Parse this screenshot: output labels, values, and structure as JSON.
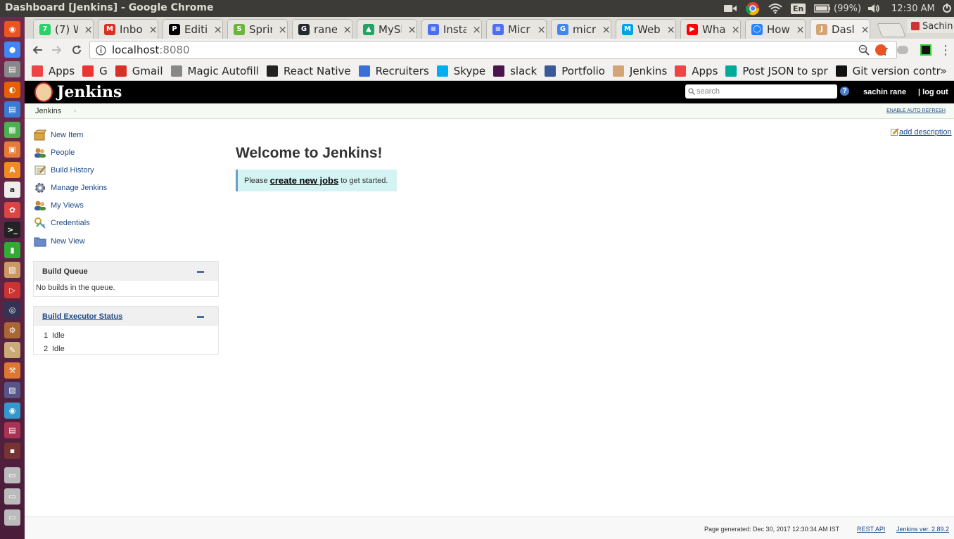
{
  "os": {
    "window_title": "Dashboard [Jenkins] - Google Chrome",
    "battery": "(99%)",
    "clock": "12:30 AM",
    "keyboard": "En"
  },
  "browser": {
    "tabs": [
      {
        "label": "(7) W",
        "fav_color": "#25d366",
        "fav_glyph": "7"
      },
      {
        "label": "Inbo",
        "fav_color": "#d93025",
        "fav_glyph": "M"
      },
      {
        "label": "Editi",
        "fav_color": "#000000",
        "fav_glyph": "P"
      },
      {
        "label": "Sprir",
        "fav_color": "#6db33f",
        "fav_glyph": "S"
      },
      {
        "label": "rane",
        "fav_color": "#24292e",
        "fav_glyph": "G"
      },
      {
        "label": "MySl",
        "fav_color": "#1fa463",
        "fav_glyph": "▲"
      },
      {
        "label": "Insta",
        "fav_color": "#4c6ef5",
        "fav_glyph": "≡"
      },
      {
        "label": "Micr",
        "fav_color": "#4c6ef5",
        "fav_glyph": "≡"
      },
      {
        "label": "micr",
        "fav_color": "#4285f4",
        "fav_glyph": "G"
      },
      {
        "label": "Web",
        "fav_color": "#00a2e8",
        "fav_glyph": "M"
      },
      {
        "label": "Wha",
        "fav_color": "#ff0000",
        "fav_glyph": "▶"
      },
      {
        "label": "How",
        "fav_color": "#2684ff",
        "fav_glyph": "◯"
      },
      {
        "label": "Dasl",
        "fav_color": "#d4a574",
        "fav_glyph": "J"
      }
    ],
    "profile_name": "Sachin",
    "url_host": "localhost",
    "url_port": ":8080",
    "bookmarks": [
      {
        "label": "Apps",
        "color": "#e44"
      },
      {
        "label": "G",
        "color": "#e33"
      },
      {
        "label": "Gmail",
        "color": "#d93025"
      },
      {
        "label": "Magic Autofill",
        "color": "#888"
      },
      {
        "label": "React Native",
        "color": "#222"
      },
      {
        "label": "Recruiters",
        "color": "#3a6fd8"
      },
      {
        "label": "Skype",
        "color": "#00aff0"
      },
      {
        "label": "slack",
        "color": "#4a154b"
      },
      {
        "label": "Portfolio",
        "color": "#3b5998"
      },
      {
        "label": "Jenkins",
        "color": "#d4a574"
      },
      {
        "label": "Apps",
        "color": "#e44"
      },
      {
        "label": "Post JSON to spr",
        "color": "#0a9"
      },
      {
        "label": "Git version contr",
        "color": "#111"
      }
    ],
    "more_bookmarks": "»"
  },
  "jenkins": {
    "logo_text": "Jenkins",
    "search_placeholder": "search",
    "help": "?",
    "user": "sachin rane",
    "logout": "| log out",
    "breadcrumb": "Jenkins",
    "enable_auto_refresh": "ENABLE AUTO REFRESH",
    "add_description": "add description",
    "tasks": [
      {
        "label": "New Item",
        "icon": "new-item-icon"
      },
      {
        "label": "People",
        "icon": "people-icon"
      },
      {
        "label": "Build History",
        "icon": "build-history-icon"
      },
      {
        "label": "Manage Jenkins",
        "icon": "gear-icon"
      },
      {
        "label": "My Views",
        "icon": "my-views-icon"
      },
      {
        "label": "Credentials",
        "icon": "credentials-icon"
      },
      {
        "label": "New View",
        "icon": "folder-icon"
      }
    ],
    "build_queue": {
      "title": "Build Queue",
      "empty": "No builds in the queue."
    },
    "executors": {
      "title": "Build Executor Status",
      "rows": [
        {
          "num": "1",
          "status": "Idle"
        },
        {
          "num": "2",
          "status": "Idle"
        }
      ]
    },
    "welcome_title": "Welcome to Jenkins!",
    "notice_prefix": "Please",
    "notice_link": "create new jobs",
    "notice_suffix": "to get started.",
    "footer": {
      "generated": "Page generated: Dec 30, 2017 12:30:34 AM IST",
      "rest_api": "REST API",
      "version": "Jenkins ver. 2.89.2"
    }
  }
}
